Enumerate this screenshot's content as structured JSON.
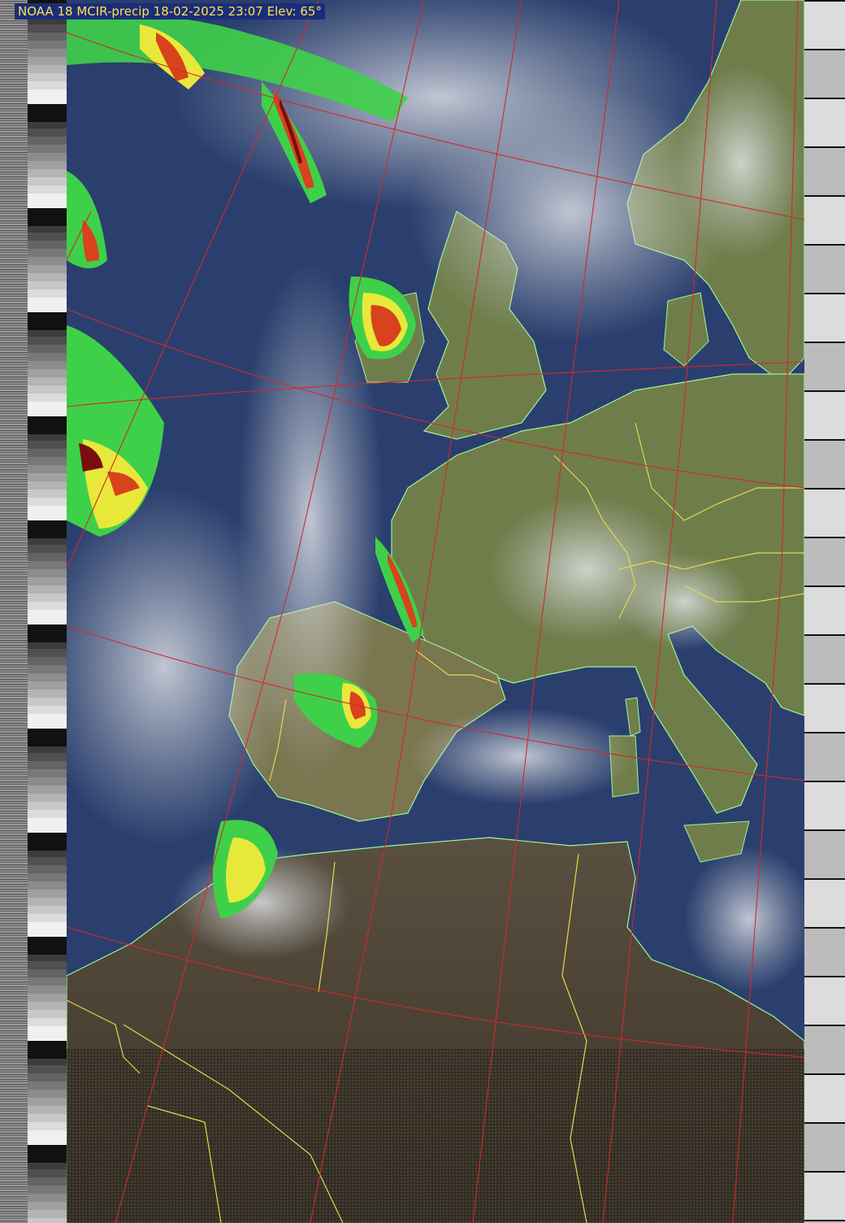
{
  "header": {
    "satellite": "NOAA 18",
    "product": "MCIR-precip",
    "date": "18-02-2025",
    "time": "23:07",
    "elevation_label": "Elev: 65°",
    "text": "NOAA 18 MCIR-precip 18-02-2025 23:07 Elev: 65°"
  },
  "colors": {
    "ocean": "#2a3f6e",
    "land_green": "#6f7d4a",
    "land_desert": "#4a4535",
    "cloud": "#c8ccd0",
    "coastline": "#9cf59c",
    "borders": "#e6d84a",
    "graticule": "#d02a2a",
    "precip_light": "#3fd04a",
    "precip_moderate": "#e8e83a",
    "precip_heavy": "#d8421c",
    "precip_extreme": "#7a0d0d",
    "header_bg": "#1b2d7a",
    "header_text": "#ffe24a"
  },
  "icons": [
    "telemetry-wedge-strip",
    "sync-marker"
  ]
}
